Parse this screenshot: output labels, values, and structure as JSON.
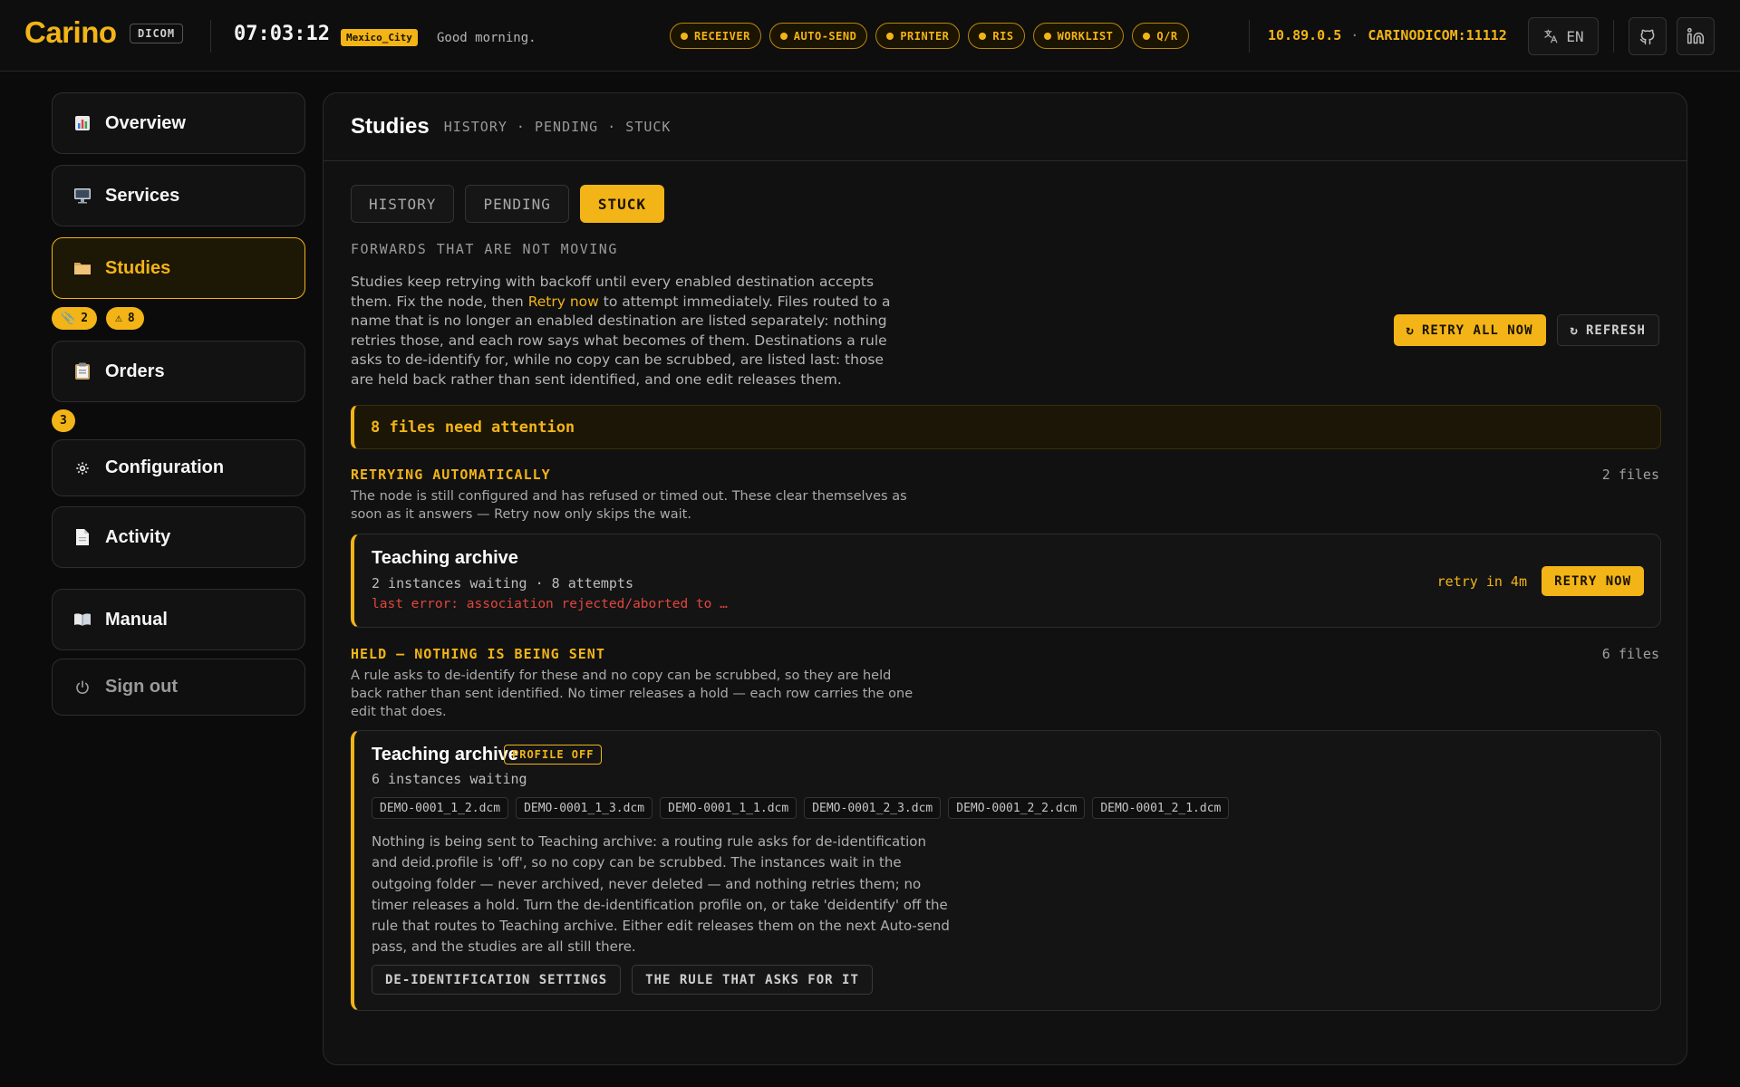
{
  "header": {
    "brand": "Carino",
    "brand_tag": "DICOM",
    "clock": "07:03:12",
    "timezone": "Mexico_City",
    "greeting": "Good morning.",
    "services": [
      {
        "label": "RECEIVER",
        "status_color": "#f2b417"
      },
      {
        "label": "AUTO-SEND",
        "status_color": "#f2b417"
      },
      {
        "label": "PRINTER",
        "status_color": "#f2b417"
      },
      {
        "label": "RIS",
        "status_color": "#f2b417"
      },
      {
        "label": "WORKLIST",
        "status_color": "#f2b417"
      },
      {
        "label": "Q/R",
        "status_color": "#f2b417"
      }
    ],
    "ip": "10.89.0.5",
    "ae": "CARINODICOM:11112",
    "language": "EN",
    "icons": [
      "translate-icon",
      "github-icon",
      "linkedin-icon"
    ]
  },
  "sidebar": {
    "items": [
      {
        "label": "Overview",
        "icon": "bar-chart-icon"
      },
      {
        "label": "Services",
        "icon": "monitor-icon"
      },
      {
        "label": "Studies",
        "icon": "folder-icon",
        "active": true
      },
      {
        "label": "Orders",
        "icon": "clipboard-icon"
      },
      {
        "label": "Configuration",
        "icon": "gear-icon"
      },
      {
        "label": "Activity",
        "icon": "document-icon"
      },
      {
        "label": "Manual",
        "icon": "book-icon"
      },
      {
        "label": "Sign out",
        "icon": "power-icon"
      }
    ],
    "studies_badges": [
      {
        "icon": "paperclip-icon",
        "count": "2"
      },
      {
        "icon": "warning-icon",
        "count": "8"
      }
    ],
    "orders_badge": "3"
  },
  "main": {
    "title": "Studies",
    "subtitle": "HISTORY · PENDING · STUCK",
    "tabs": [
      {
        "label": "HISTORY"
      },
      {
        "label": "PENDING"
      },
      {
        "label": "STUCK",
        "active": true
      }
    ],
    "kicker": "FORWARDS THAT ARE NOT MOVING",
    "intro_before": "Studies keep retrying with backoff until every enabled destination accepts them. Fix the node, then ",
    "intro_link": "Retry now",
    "intro_after": " to attempt immediately. Files routed to a name that is no longer an enabled destination are listed separately: nothing retries those, and each row says what becomes of them. Destinations a rule asks to de-identify for, while no copy can be scrubbed, are listed last: those are held back rather than sent identified, and one edit releases them.",
    "retry_all_label": "RETRY ALL NOW",
    "refresh_label": "REFRESH",
    "alert": "8 files need attention",
    "retrying": {
      "title": "RETRYING AUTOMATICALLY",
      "count": "2 files",
      "desc": "The node is still configured and has refused or timed out. These clear themselves as soon as it answers — Retry now only skips the wait.",
      "card": {
        "name": "Teaching archive",
        "meta": "2 instances waiting · 8 attempts",
        "error": "last error: association rejected/aborted to …",
        "retry_in": "retry in 4m",
        "button": "RETRY NOW"
      }
    },
    "held": {
      "title": "HELD — NOTHING IS BEING SENT",
      "count": "6 files",
      "desc": "A rule asks to de-identify for these and no copy can be scrubbed, so they are held back rather than sent identified. No timer releases a hold — each row carries the one edit that does.",
      "card": {
        "name": "Teaching archive",
        "badge": "PROFILE OFF",
        "meta": "6 instances waiting",
        "files": [
          "DEMO-0001_1_2.dcm",
          "DEMO-0001_1_3.dcm",
          "DEMO-0001_1_1.dcm",
          "DEMO-0001_2_3.dcm",
          "DEMO-0001_2_2.dcm",
          "DEMO-0001_2_1.dcm"
        ],
        "body": "Nothing is being sent to Teaching archive: a routing rule asks for de-identification and deid.profile is 'off', so no copy can be scrubbed. The instances wait in the outgoing folder — never archived, never deleted — and nothing retries them; no timer releases a hold. Turn the de-identification profile on, or take 'deidentify' off the rule that routes to Teaching archive. Either edit releases them on the next Auto-send pass, and the studies are all still there.",
        "action1": "DE-IDENTIFICATION SETTINGS",
        "action2": "THE RULE THAT ASKS FOR IT"
      }
    }
  }
}
